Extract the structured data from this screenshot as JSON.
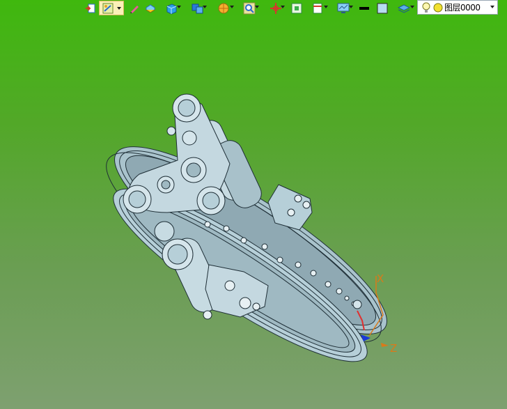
{
  "toolbar": {
    "items": [
      {
        "name": "exit-icon"
      },
      {
        "name": "sketch-mode-icon",
        "active": true
      },
      {
        "name": "pen-icon"
      },
      {
        "name": "face-extrude-icon"
      },
      {
        "name": "solid-box-icon"
      },
      {
        "name": "multi-solid-icon"
      },
      {
        "name": "render-style-icon"
      },
      {
        "name": "zoom-view-icon"
      },
      {
        "name": "move-origin-icon"
      },
      {
        "name": "grid-snap-icon"
      },
      {
        "name": "align-icon"
      },
      {
        "name": "display-settings-icon"
      },
      {
        "name": "line-color-icon"
      },
      {
        "name": "fill-color-icon"
      },
      {
        "name": "layer-manager-icon"
      }
    ],
    "layer_select": {
      "value": "图层0000",
      "icons": [
        "bulb-icon",
        "layer-color-icon"
      ]
    }
  },
  "viewport": {
    "background_top": "#3fb80e",
    "background_bottom": "#7ea070",
    "model_color": "#b6cfd8",
    "triad": {
      "x_label": "X",
      "z_label": "Z",
      "x_color": "#d97a1a",
      "z_color": "#d97a1a"
    }
  }
}
